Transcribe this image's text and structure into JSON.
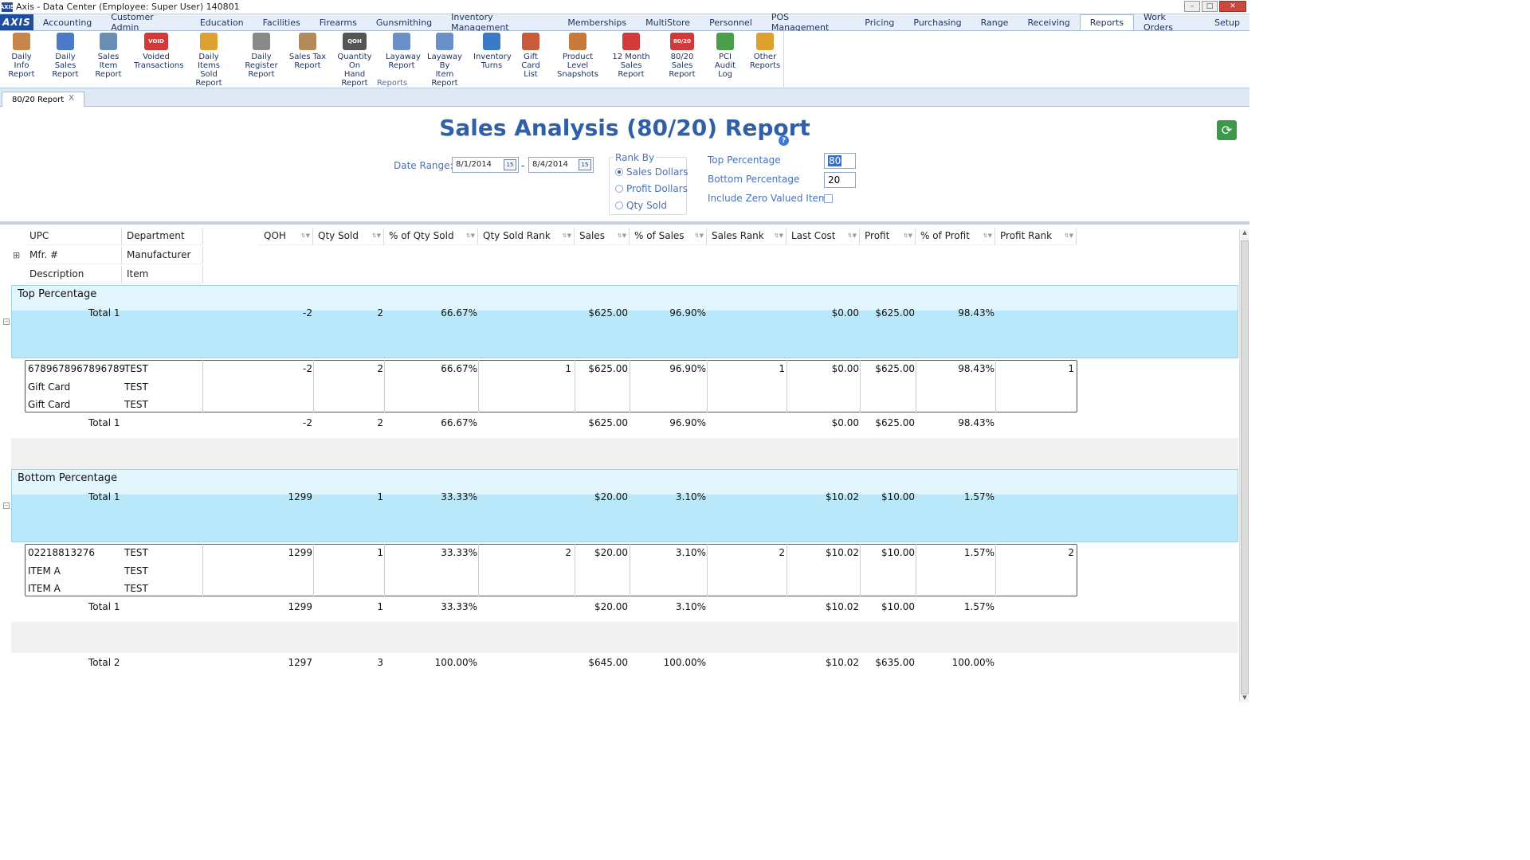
{
  "window": {
    "title": "Axis - Data Center  (Employee: Super User) 140801",
    "app_icon": "AXIS"
  },
  "menu": {
    "logo": "AXIS",
    "items": [
      "Accounting",
      "Customer Admin",
      "Education",
      "Facilities",
      "Firearms",
      "Gunsmithing",
      "Inventory Management",
      "Memberships",
      "MultiStore",
      "Personnel",
      "POS Management",
      "Pricing",
      "Purchasing",
      "Range",
      "Receiving",
      "Reports",
      "Work Orders",
      "Setup"
    ],
    "active": "Reports"
  },
  "ribbon": {
    "group_label": "Reports",
    "buttons": [
      {
        "l1": "Daily Info",
        "l2": "Report",
        "icon": "daily-info-icon",
        "color": "#c9864a"
      },
      {
        "l1": "Daily Sales",
        "l2": "Report",
        "icon": "daily-sales-icon",
        "color": "#4a7ac9"
      },
      {
        "l1": "Sales Item",
        "l2": "Report",
        "icon": "sales-item-icon",
        "color": "#6a8fb5"
      },
      {
        "l1": "Voided",
        "l2": "Transactions",
        "icon": "voided-icon",
        "color": "#d23a3a",
        "text": "VOID"
      },
      {
        "l1": "Daily Items",
        "l2": "Sold Report",
        "icon": "daily-items-icon",
        "color": "#e0a030"
      },
      {
        "l1": "Daily Register",
        "l2": "Report",
        "icon": "daily-register-icon",
        "color": "#8a8a8a"
      },
      {
        "l1": "Sales Tax",
        "l2": "Report",
        "icon": "sales-tax-icon",
        "color": "#b58a5a"
      },
      {
        "l1": "Quantity On",
        "l2": "Hand Report",
        "icon": "qoh-icon",
        "color": "#555555",
        "text": "QOH"
      },
      {
        "l1": "Layaway",
        "l2": "Report",
        "icon": "layaway-icon",
        "color": "#6a8fc9"
      },
      {
        "l1": "Layaway By",
        "l2": "Item Report",
        "icon": "layaway-item-icon",
        "color": "#6a8fc9"
      },
      {
        "l1": "Inventory",
        "l2": "Turns",
        "icon": "inventory-turns-icon",
        "color": "#3a7ac9"
      },
      {
        "l1": "Gift Card",
        "l2": "List",
        "icon": "gift-card-icon",
        "color": "#c95a3a"
      },
      {
        "l1": "Product Level",
        "l2": "Snapshots",
        "icon": "product-level-icon",
        "color": "#c97a3a"
      },
      {
        "l1": "12 Month",
        "l2": "Sales Report",
        "icon": "twelve-month-icon",
        "color": "#d23a3a"
      },
      {
        "l1": "80/20 Sales",
        "l2": "Report",
        "icon": "eighty-twenty-icon",
        "color": "#d23a3a",
        "text": "80/20"
      },
      {
        "l1": "PCI Audit",
        "l2": "Log",
        "icon": "pci-audit-icon",
        "color": "#4aa04a"
      },
      {
        "l1": "Other",
        "l2": "Reports",
        "icon": "other-reports-icon",
        "color": "#e0a030"
      }
    ]
  },
  "doc_tab": {
    "label": "80/20 Report",
    "close": "X"
  },
  "report": {
    "title": "Sales Analysis (80/20) Report",
    "help": "?",
    "date_range_label": "Date Range:",
    "date_from": "8/1/2014",
    "date_sep": "-",
    "date_to": "8/4/2014",
    "cal_label": "15",
    "rank_by_label": "Rank By",
    "rank_options": [
      "Sales Dollars",
      "Profit Dollars",
      "Qty Sold"
    ],
    "rank_selected": "Sales Dollars",
    "top_pct_label": "Top Percentage",
    "top_pct": "80",
    "bottom_pct_label": "Bottom Percentage",
    "bottom_pct": "20",
    "zero_label": "Include Zero Valued Items"
  },
  "grid": {
    "left_headers": [
      [
        "UPC",
        "Department"
      ],
      [
        "Mfr. #",
        "Manufacturer"
      ],
      [
        "Description",
        "Item"
      ]
    ],
    "columns": [
      "QOH",
      "Qty Sold",
      "% of Qty Sold",
      "Qty Sold Rank",
      "Sales",
      "% of Sales",
      "Sales Rank",
      "Last Cost",
      "Profit",
      "% of Profit",
      "Profit Rank"
    ],
    "groups": [
      {
        "name": "Top Percentage",
        "total_label": "Total 1",
        "totals": [
          "-2",
          "2",
          "66.67%",
          "",
          "$625.00",
          "96.90%",
          "",
          "$0.00",
          "$625.00",
          "98.43%",
          ""
        ],
        "record": {
          "left": [
            [
              "6789678967896789",
              "TEST"
            ],
            [
              "Gift Card",
              "TEST"
            ],
            [
              "Gift Card",
              "TEST"
            ]
          ],
          "values": [
            "-2",
            "2",
            "66.67%",
            "1",
            "$625.00",
            "96.90%",
            "1",
            "$0.00",
            "$625.00",
            "98.43%",
            "1"
          ]
        },
        "sub_total_label": "Total 1",
        "sub_totals": [
          "-2",
          "2",
          "66.67%",
          "",
          "$625.00",
          "96.90%",
          "",
          "$0.00",
          "$625.00",
          "98.43%",
          ""
        ]
      },
      {
        "name": "Bottom Percentage",
        "total_label": "Total 1",
        "totals": [
          "1299",
          "1",
          "33.33%",
          "",
          "$20.00",
          "3.10%",
          "",
          "$10.02",
          "$10.00",
          "1.57%",
          ""
        ],
        "record": {
          "left": [
            [
              "02218813276",
              "TEST"
            ],
            [
              "ITEM A",
              "TEST"
            ],
            [
              "ITEM A",
              "TEST"
            ]
          ],
          "values": [
            "1299",
            "1",
            "33.33%",
            "2",
            "$20.00",
            "3.10%",
            "2",
            "$10.02",
            "$10.00",
            "1.57%",
            "2"
          ]
        },
        "sub_total_label": "Total 1",
        "sub_totals": [
          "1299",
          "1",
          "33.33%",
          "",
          "$20.00",
          "3.10%",
          "",
          "$10.02",
          "$10.00",
          "1.57%",
          ""
        ]
      }
    ],
    "grand_total_label": "Total 2",
    "grand_totals": [
      "1297",
      "3",
      "100.00%",
      "",
      "$645.00",
      "100.00%",
      "",
      "$10.02",
      "$635.00",
      "100.00%",
      ""
    ]
  },
  "colors": {
    "band": "#b9e8fb",
    "band_light": "#e3f6fd",
    "title": "#2f5fa8"
  }
}
